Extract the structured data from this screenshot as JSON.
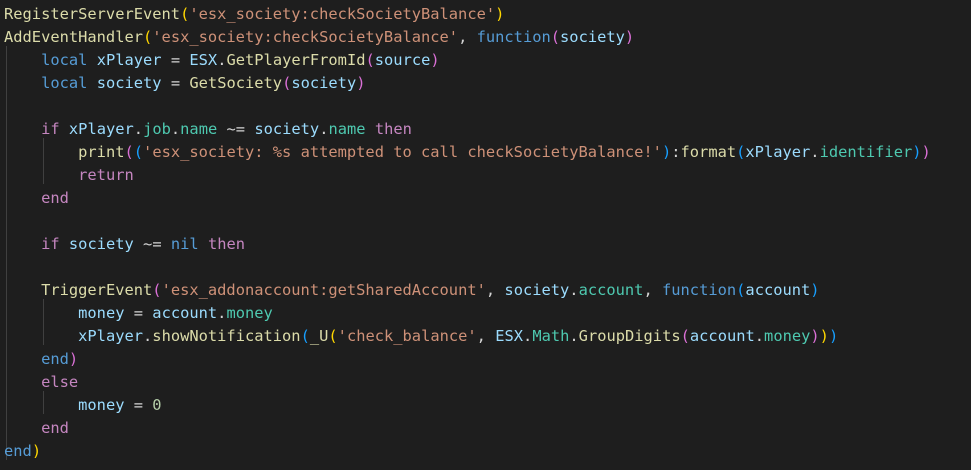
{
  "code_lines": [
    "RegisterServerEvent('esx_society:checkSocietyBalance')",
    "AddEventHandler('esx_society:checkSocietyBalance', function(society)",
    "    local xPlayer = ESX.GetPlayerFromId(source)",
    "    local society = GetSociety(society)",
    "",
    "    if xPlayer.job.name ~= society.name then",
    "        print(('esx_society: %s attempted to call checkSocietyBalance!'):format(xPlayer.identifier))",
    "        return",
    "    end",
    "",
    "    if society ~= nil then",
    "",
    "    TriggerEvent('esx_addonaccount:getSharedAccount', society.account, function(account)",
    "        money = account.money",
    "        xPlayer.showNotification(_U('check_balance', ESX.Math.GroupDigits(account.money)))",
    "    end)",
    "    else",
    "        money = 0",
    "    end",
    "end)"
  ],
  "t": {
    "registerServerEvent": "RegisterServerEvent",
    "addEventHandler": "AddEventHandler",
    "eventName": "'esx_society:checkSocietyBalance'",
    "function": "function",
    "local": "local",
    "xPlayer": "xPlayer",
    "society": "society",
    "esx": "ESX",
    "getPlayerFromId": "GetPlayerFromId",
    "source": "source",
    "getSociety": "GetSociety",
    "if": "if",
    "job": "job",
    "name": "name",
    "neq": " ~= ",
    "then": "then",
    "print": "print",
    "printMsg": "'esx_society: %s attempted to call checkSocietyBalance!'",
    "format": "format",
    "identifier": "identifier",
    "return": "return",
    "end": "end",
    "nil": "nil",
    "triggerEvent": "TriggerEvent",
    "sharedEvent": "'esx_addonaccount:getSharedAccount'",
    "account": "account",
    "money": "money",
    "eq": " = ",
    "showNotification": "showNotification",
    "u": "_U",
    "checkBalance": "'check_balance'",
    "math": "Math",
    "groupDigits": "GroupDigits",
    "else": "else",
    "zero": "0",
    "lp": "(",
    "rp": ")",
    "dot": ".",
    "colon": ":",
    "comma": ", ",
    "sp": " "
  },
  "colors": {
    "background": "#1e1e1e",
    "keyword": "#569cd6",
    "control": "#c586c0",
    "function": "#dcdcaa",
    "string": "#ce9178",
    "variable": "#9cdcfe",
    "property": "#4ec9b0",
    "number": "#b5cea8",
    "bracket_1": "#ffd700",
    "bracket_2": "#da70d6",
    "bracket_3": "#179fff"
  }
}
